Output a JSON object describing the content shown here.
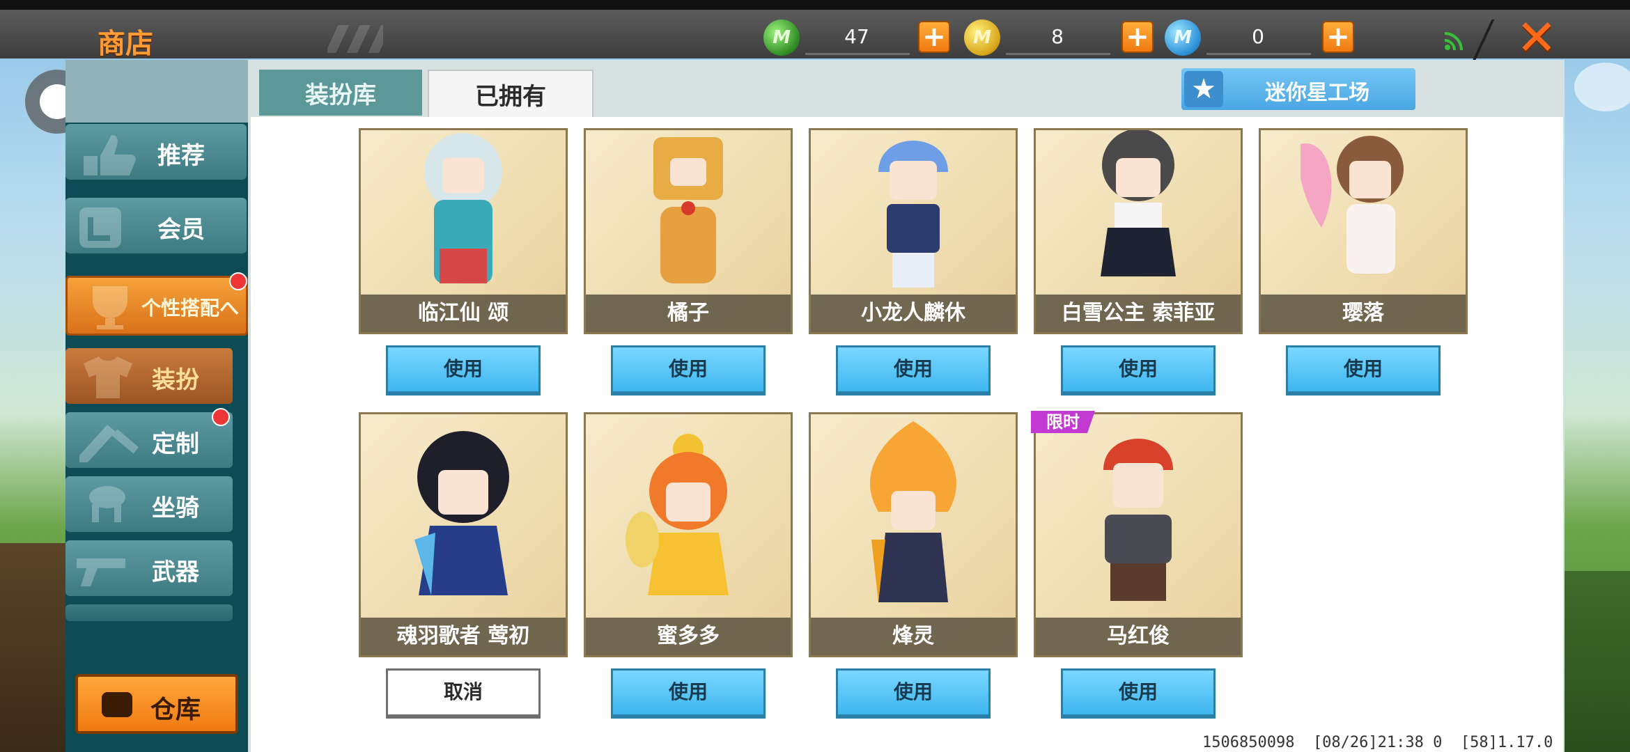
{
  "header": {
    "title": "商店",
    "currencies": [
      {
        "icon": "mini-bean-coin-icon",
        "value": "47"
      },
      {
        "icon": "mini-coin-icon",
        "value": "8"
      },
      {
        "icon": "mini-point-icon",
        "value": "0"
      }
    ],
    "plus_label": "+",
    "close_label": "✕"
  },
  "sidebar": {
    "items": [
      {
        "label": "推荐"
      },
      {
        "label": "会员"
      },
      {
        "label": "个性搭配へ"
      },
      {
        "label": "装扮"
      },
      {
        "label": "定制"
      },
      {
        "label": "坐骑"
      },
      {
        "label": "武器"
      }
    ],
    "warehouse_label": "仓库"
  },
  "tabs": [
    {
      "label": "装扮库"
    },
    {
      "label": "已拥有"
    }
  ],
  "workshop_label": "迷你星工场",
  "skins": [
    {
      "name": "临江仙 颂",
      "action": "使用"
    },
    {
      "name": "橘子",
      "action": "使用"
    },
    {
      "name": "小龙人麟休",
      "action": "使用"
    },
    {
      "name": "白雪公主 索菲亚",
      "action": "使用"
    },
    {
      "name": "璎落",
      "action": "使用"
    },
    {
      "name": "魂羽歌者 莺初",
      "action": "取消"
    },
    {
      "name": "蜜多多",
      "action": "使用"
    },
    {
      "name": "烽灵",
      "action": "使用"
    },
    {
      "name": "马红俊",
      "action": "使用"
    }
  ],
  "limited_tag": "限时",
  "footer": "1506850098  [08/26]21:38 0  [58]1.17.0",
  "colors": {
    "accent_orange": "#f07a12",
    "use_button_blue": "#3eb6ef",
    "sidebar_teal": "#0d4b55",
    "limited_purple": "#c23ad1"
  }
}
